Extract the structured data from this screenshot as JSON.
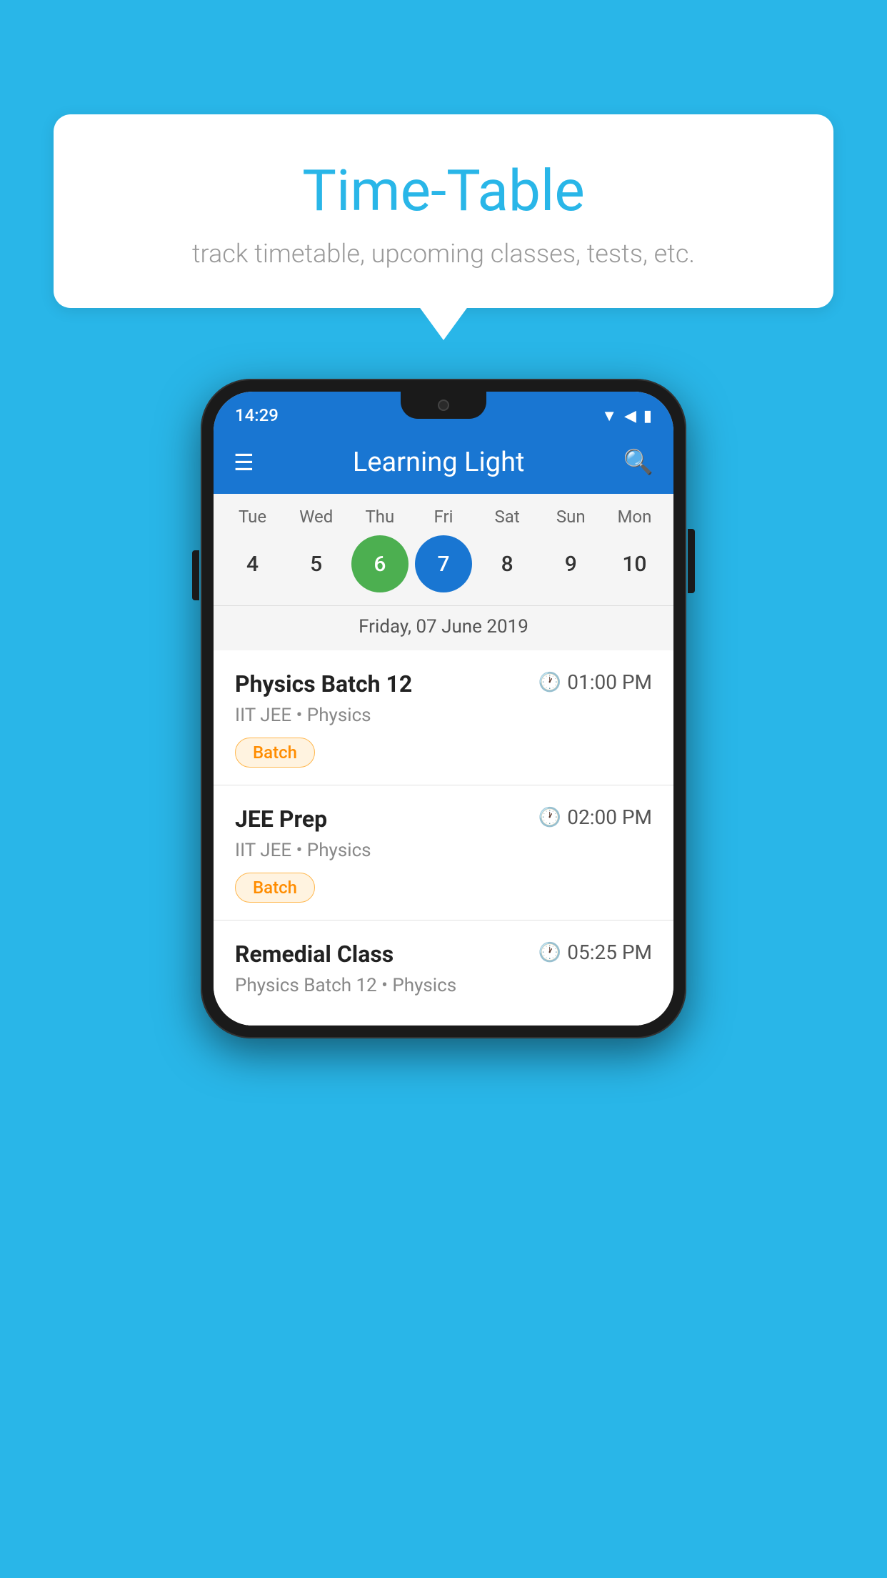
{
  "background_color": "#29B6E8",
  "speech_bubble": {
    "title": "Time-Table",
    "subtitle": "track timetable, upcoming classes, tests, etc."
  },
  "phone": {
    "status_bar": {
      "time": "14:29"
    },
    "app_bar": {
      "title": "Learning Light"
    },
    "calendar": {
      "days": [
        {
          "label": "Tue",
          "number": "4"
        },
        {
          "label": "Wed",
          "number": "5"
        },
        {
          "label": "Thu",
          "number": "6",
          "state": "today"
        },
        {
          "label": "Fri",
          "number": "7",
          "state": "selected"
        },
        {
          "label": "Sat",
          "number": "8"
        },
        {
          "label": "Sun",
          "number": "9"
        },
        {
          "label": "Mon",
          "number": "10"
        }
      ],
      "selected_date": "Friday, 07 June 2019"
    },
    "classes": [
      {
        "name": "Physics Batch 12",
        "time": "01:00 PM",
        "meta": "IIT JEE • Physics",
        "badge": "Batch"
      },
      {
        "name": "JEE Prep",
        "time": "02:00 PM",
        "meta": "IIT JEE • Physics",
        "badge": "Batch"
      },
      {
        "name": "Remedial Class",
        "time": "05:25 PM",
        "meta": "Physics Batch 12 • Physics",
        "badge": null
      }
    ]
  }
}
